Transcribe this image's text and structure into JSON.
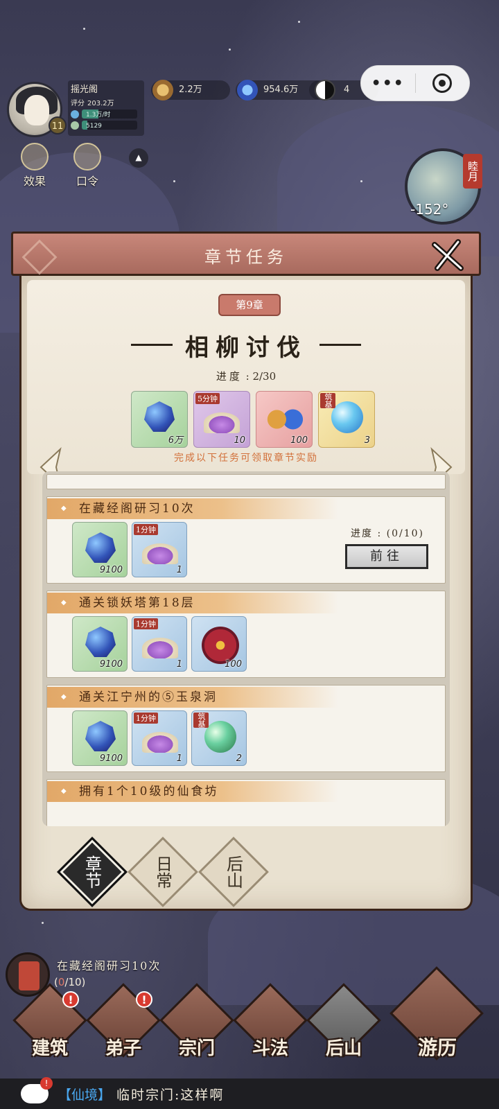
{
  "player": {
    "name": "摇光阁",
    "level": "11",
    "score_label": "评分",
    "score": "203.2万",
    "rate": "1.3万/时",
    "secondary": "5129"
  },
  "resources": [
    {
      "icon": "spirit-stone-pouch-icon",
      "value": "2.2万"
    },
    {
      "icon": "gem-icon",
      "value": "954.6万"
    },
    {
      "icon": "yin-yang-icon",
      "value": "4"
    }
  ],
  "hud_buttons": [
    {
      "icon": "effect-icon",
      "label": "效果"
    },
    {
      "icon": "key-icon",
      "label": "口令"
    }
  ],
  "clock": {
    "season": "睦月",
    "temperature": "-152°"
  },
  "modal": {
    "title": "章节任务",
    "chapter_tag": "第9章",
    "chapter_title": "相柳讨伐",
    "progress_label": "进度",
    "progress_value": "2/30",
    "hint": "完成以下任务可领取章节实励",
    "rewards": [
      {
        "icon": "gem-icon",
        "count": "6万",
        "style": "green",
        "tag": ""
      },
      {
        "icon": "purple-powder-icon",
        "count": "10",
        "style": "purple",
        "tag": "5分钟"
      },
      {
        "icon": "cloud-icon",
        "count": "100",
        "style": "pink",
        "tag": ""
      },
      {
        "icon": "orb-icon",
        "count": "3",
        "style": "gold",
        "tag": "筑基"
      }
    ],
    "tasks": [
      {
        "title": "在藏经阁研习10次",
        "progress_label": "进度",
        "progress": "(0/10)",
        "go_label": "前往",
        "items": [
          {
            "icon": "gem-icon",
            "count": "9100",
            "style": "green",
            "tag": ""
          },
          {
            "icon": "purple-powder-icon",
            "count": "1",
            "style": "blue",
            "tag": "1分钟"
          }
        ]
      },
      {
        "title": "通关锁妖塔第18层",
        "items": [
          {
            "icon": "gem-icon",
            "count": "9100",
            "style": "green",
            "tag": ""
          },
          {
            "icon": "purple-powder-icon",
            "count": "1",
            "style": "blue",
            "tag": "1分钟"
          },
          {
            "icon": "seal-icon",
            "count": "100",
            "style": "blue",
            "tag": ""
          }
        ]
      },
      {
        "title": "通关江宁州的⑤玉泉洞",
        "items": [
          {
            "icon": "gem-icon",
            "count": "9100",
            "style": "green",
            "tag": ""
          },
          {
            "icon": "purple-powder-icon",
            "count": "1",
            "style": "blue",
            "tag": "1分钟"
          },
          {
            "icon": "green-orb-icon",
            "count": "2",
            "style": "blue",
            "tag": "筑基"
          }
        ]
      },
      {
        "title": "拥有1个10级的仙食坊"
      }
    ],
    "tabs": [
      {
        "label": "章节",
        "active": true
      },
      {
        "label": "日常",
        "active": false
      },
      {
        "label": "后山",
        "active": false
      }
    ]
  },
  "quest_tracker": {
    "text": "在藏经阁研习10次",
    "progress_open": "(",
    "progress_current": "0",
    "progress_rest": "/10)"
  },
  "nav": [
    {
      "label": "建筑",
      "badge": "!"
    },
    {
      "label": "弟子",
      "badge": "!"
    },
    {
      "label": "宗门",
      "badge": ""
    },
    {
      "label": "斗法",
      "badge": ""
    },
    {
      "label": "后山",
      "badge": ""
    },
    {
      "label": "游历",
      "badge": ""
    }
  ],
  "chat": {
    "badge": "!",
    "channel": "【仙境】",
    "message": "临时宗门:这样啊"
  }
}
